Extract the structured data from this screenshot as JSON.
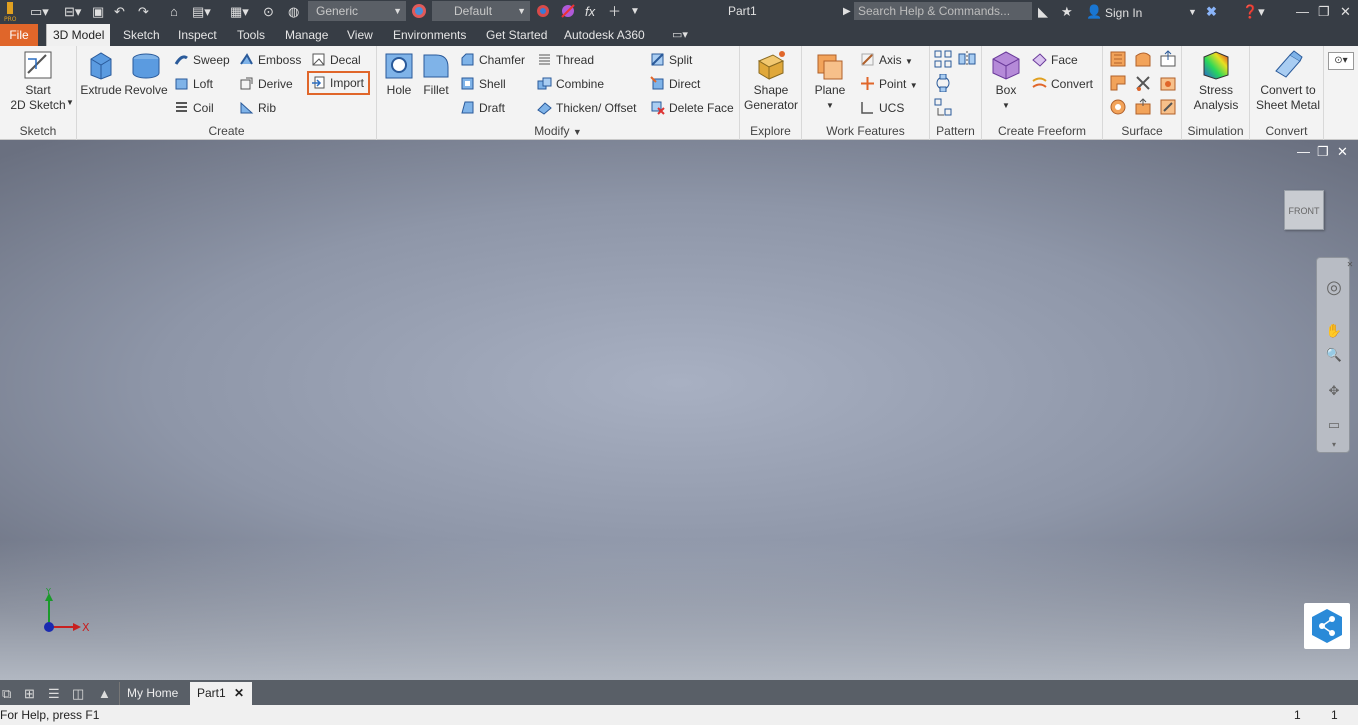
{
  "title_bar": {
    "app_icon_text": "PRO",
    "appearance_select": "Generic",
    "material_select": "Default",
    "document_title": "Part1",
    "search_placeholder": "Search Help & Commands...",
    "sign_in": "Sign In"
  },
  "tabs": [
    "File",
    "3D Model",
    "Sketch",
    "Inspect",
    "Tools",
    "Manage",
    "View",
    "Environments",
    "Get Started",
    "Autodesk A360"
  ],
  "active_tab": "3D Model",
  "ribbon": {
    "sketch": {
      "label": "Sketch",
      "start_sketch": "Start\n2D Sketch"
    },
    "create": {
      "label": "Create",
      "extrude": "Extrude",
      "revolve": "Revolve",
      "sweep": "Sweep",
      "loft": "Loft",
      "coil": "Coil",
      "emboss": "Emboss",
      "derive": "Derive",
      "rib": "Rib",
      "decal": "Decal",
      "import": "Import"
    },
    "modify": {
      "label": "Modify",
      "hole": "Hole",
      "fillet": "Fillet",
      "chamfer": "Chamfer",
      "shell": "Shell",
      "draft": "Draft",
      "thread": "Thread",
      "combine": "Combine",
      "thicken": "Thicken/ Offset",
      "split": "Split",
      "direct": "Direct",
      "delete_face": "Delete Face"
    },
    "explore": {
      "label": "Explore",
      "shape_generator": "Shape\nGenerator"
    },
    "work_features": {
      "label": "Work Features",
      "plane": "Plane",
      "axis": "Axis",
      "point": "Point",
      "ucs": "UCS"
    },
    "pattern": {
      "label": "Pattern"
    },
    "freeform": {
      "label": "Create Freeform",
      "box": "Box",
      "face": "Face",
      "convert": "Convert"
    },
    "surface": {
      "label": "Surface"
    },
    "simulation": {
      "label": "Simulation",
      "stress": "Stress\nAnalysis"
    },
    "convert": {
      "label": "Convert",
      "sheet_metal": "Convert to\nSheet Metal"
    }
  },
  "viewport": {
    "viewcube_face": "FRONT",
    "axis_x": "X",
    "axis_y": "Y"
  },
  "doc_tabs": {
    "home": "My Home",
    "part": "Part1"
  },
  "status": {
    "help": "For Help, press F1",
    "count1": "1",
    "count2": "1"
  },
  "colors": {
    "accent": "#e0662a",
    "titlebar": "#373d45",
    "ribbon": "#f3f3f3"
  }
}
